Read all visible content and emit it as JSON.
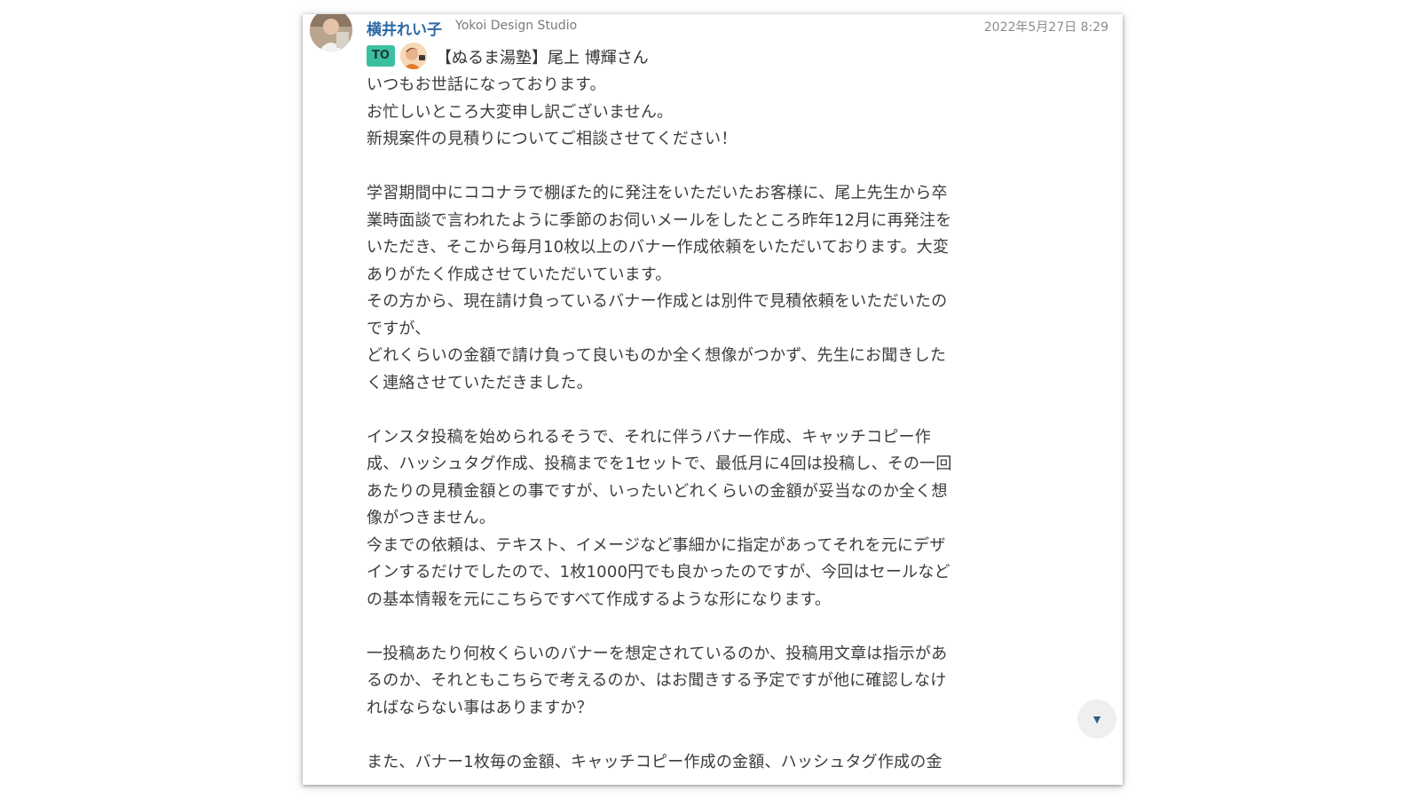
{
  "message": {
    "sender_name": "横井れい子",
    "sender_org": "Yokoi Design Studio",
    "timestamp": "2022年5月27日 8:29",
    "to_badge": "TO",
    "to_recipient": "【ぬるま湯塾】尾上 博輝さん",
    "body_lines": [
      "いつもお世話になっております。",
      "お忙しいところ大変申し訳ございません。",
      "新規案件の見積りについてご相談させてください！",
      "",
      "学習期間中にココナラで棚ぼた的に発注をいただいたお客様に、尾上先生から卒",
      "業時面談で言われたように季節のお伺いメールをしたところ昨年12月に再発注を",
      "いただき、そこから毎月10枚以上のバナー作成依頼をいただいております。大変",
      "ありがたく作成させていただいています。",
      "その方から、現在請け負っているバナー作成とは別件で見積依頼をいただいたの",
      "ですが、",
      "どれくらいの金額で請け負って良いものか全く想像がつかず、先生にお聞きした",
      "く連絡させていただきました。",
      "",
      "インスタ投稿を始められるそうで、それに伴うバナー作成、キャッチコピー作",
      "成、ハッシュタグ作成、投稿までを1セットで、最低月に4回は投稿し、その一回",
      "あたりの見積金額との事ですが、いったいどれくらいの金額が妥当なのか全く想",
      "像がつきません。",
      "今までの依頼は、テキスト、イメージなど事細かに指定があってそれを元にデザ",
      "インするだけでしたので、1枚1000円でも良かったのですが、今回はセールなど",
      "の基本情報を元にこちらですべて作成するような形になります。",
      "",
      "一投稿あたり何枚くらいのバナーを想定されているのか、投稿用文章は指示があ",
      "るのか、それともこちらで考えるのか、はお聞きする予定ですが他に確認しなけ",
      "ればならない事はありますか？",
      "",
      "また、バナー1枚毎の金額、キャッチコピー作成の金額、ハッシュタグ作成の金"
    ]
  },
  "icons": {
    "sender_avatar": "avatar",
    "recipient_avatar": "avatar",
    "scroll_button": "chevron-down-icon"
  },
  "colors": {
    "sender_name": "#2d6aa3",
    "to_badge": "#3cbfa0"
  }
}
